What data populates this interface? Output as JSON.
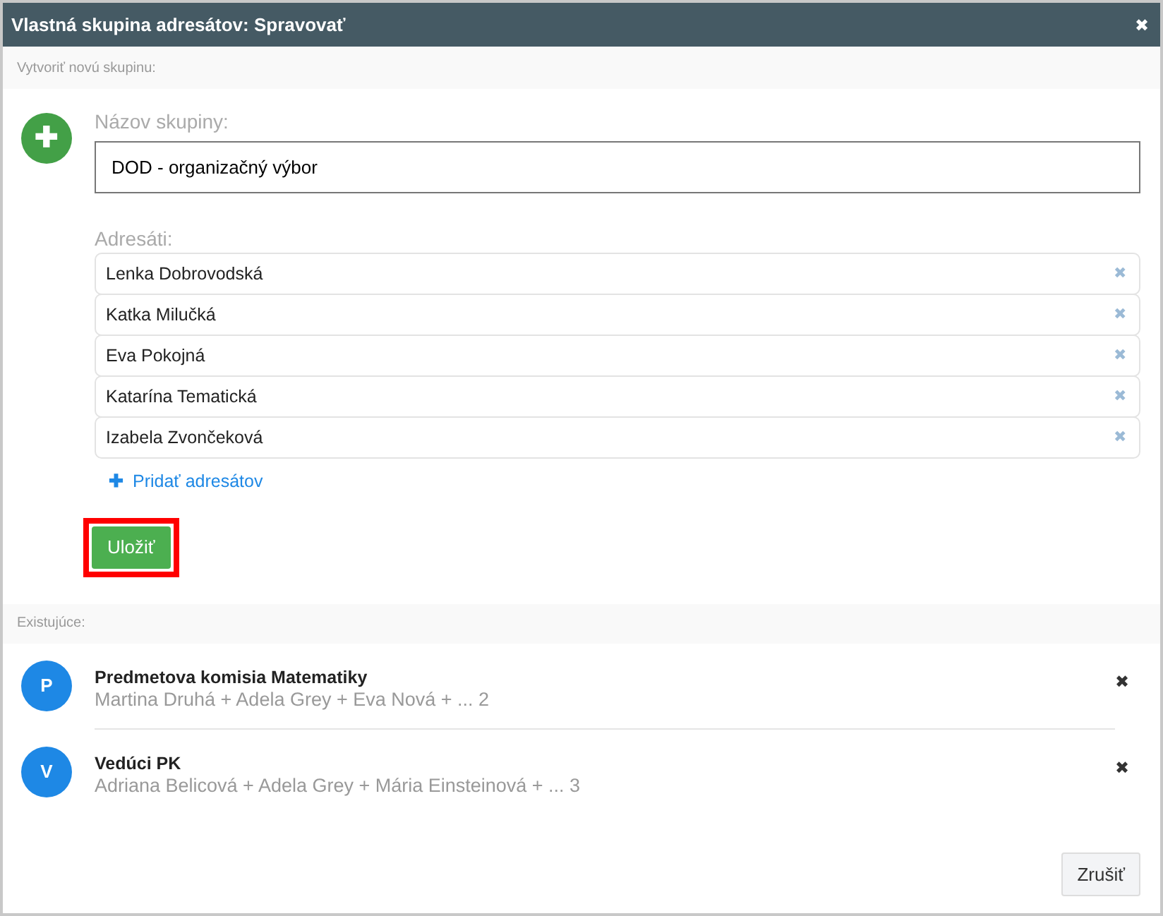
{
  "dialog": {
    "title": "Vlastná skupina adresátov: Spravovať",
    "close": "✖"
  },
  "create_section": {
    "heading": "Vytvoriť novú skupinu:",
    "add_icon": "✚",
    "name_label": "Názov skupiny:",
    "name_value": "DOD - organizačný výbor",
    "recipients_label": "Adresáti:",
    "recipients": [
      {
        "name": "Lenka Dobrovodská",
        "remove": "✖"
      },
      {
        "name": "Katka Milučká",
        "remove": "✖"
      },
      {
        "name": "Eva Pokojná",
        "remove": "✖"
      },
      {
        "name": "Katarína Tematická",
        "remove": "✖"
      },
      {
        "name": "Izabela Zvončeková",
        "remove": "✖"
      }
    ],
    "add_recipients": {
      "icon": "✚",
      "label": "Pridať adresátov"
    },
    "save_button": {
      "label": "Uložiť",
      "highlighted": true
    }
  },
  "existing_section": {
    "heading": "Existujúce:",
    "groups": [
      {
        "initial": "P",
        "name": "Predmetova komisia Matematiky",
        "members": "Martina Druhá + Adela Grey + Eva Nová + ... 2",
        "delete": "✖"
      },
      {
        "initial": "V",
        "name": "Vedúci PK",
        "members": "Adriana Belicová + Adela Grey + Mária Einsteinová + ... 3",
        "delete": "✖"
      }
    ]
  },
  "footer": {
    "cancel": "Zrušiť"
  }
}
